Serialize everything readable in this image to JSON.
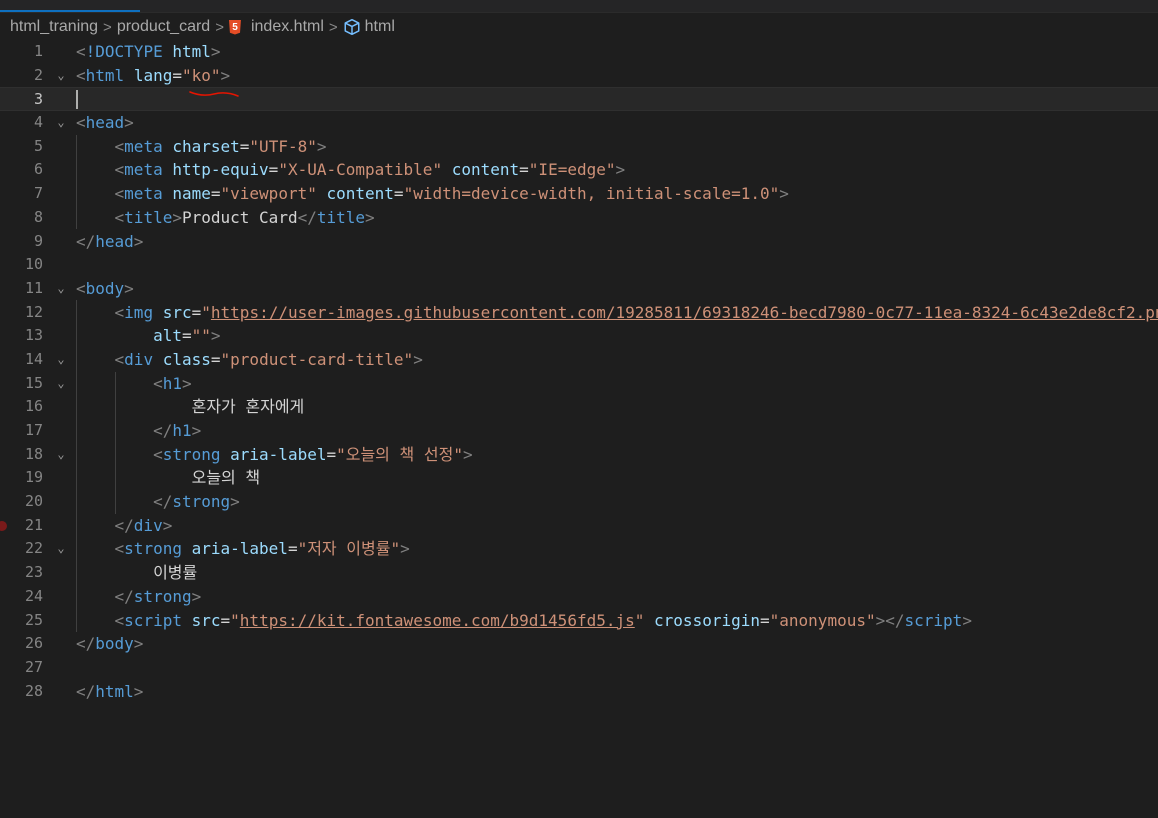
{
  "breadcrumb": {
    "items": [
      "html_traning",
      "product_card",
      "index.html",
      "html"
    ],
    "separator": ">"
  },
  "icons": {
    "file_icon": "html5-icon",
    "symbol_icon": "cube-icon",
    "html5_color": "#e44d26",
    "symbol_color": "#75beff"
  },
  "colors": {
    "background": "#1e1e1e",
    "tag": "#569cd6",
    "attribute": "#9cdcfe",
    "string": "#ce9178",
    "bracket": "#808080",
    "text": "#d4d4d4",
    "line_number": "#858585",
    "squiggle": "#e51400",
    "breakpoint": "#7a1a1a"
  },
  "editor": {
    "current_line": 3,
    "breakpoint_line": 21,
    "lines": [
      {
        "n": "1",
        "fold": "",
        "tokens": [
          {
            "t": "<",
            "c": "tag-b"
          },
          {
            "t": "!DOCTYPE ",
            "c": "tag"
          },
          {
            "t": "html",
            "c": "attr"
          },
          {
            "t": ">",
            "c": "tag-b"
          }
        ]
      },
      {
        "n": "2",
        "fold": "v",
        "tokens": [
          {
            "t": "<",
            "c": "tag-b"
          },
          {
            "t": "html",
            "c": "tag"
          },
          {
            "t": " ",
            "c": "txt"
          },
          {
            "t": "lang",
            "c": "attr"
          },
          {
            "t": "=",
            "c": "txt"
          },
          {
            "t": "\"ko\"",
            "c": "str"
          },
          {
            "t": ">",
            "c": "tag-b"
          }
        ]
      },
      {
        "n": "3",
        "fold": "",
        "tokens": []
      },
      {
        "n": "4",
        "fold": "v",
        "tokens": [
          {
            "t": "<",
            "c": "tag-b"
          },
          {
            "t": "head",
            "c": "tag"
          },
          {
            "t": ">",
            "c": "tag-b"
          }
        ]
      },
      {
        "n": "5",
        "fold": "",
        "tokens": [
          {
            "t": "    ",
            "c": "txt"
          },
          {
            "t": "<",
            "c": "tag-b"
          },
          {
            "t": "meta",
            "c": "tag"
          },
          {
            "t": " ",
            "c": "txt"
          },
          {
            "t": "charset",
            "c": "attr"
          },
          {
            "t": "=",
            "c": "txt"
          },
          {
            "t": "\"UTF-8\"",
            "c": "str"
          },
          {
            "t": ">",
            "c": "tag-b"
          }
        ]
      },
      {
        "n": "6",
        "fold": "",
        "tokens": [
          {
            "t": "    ",
            "c": "txt"
          },
          {
            "t": "<",
            "c": "tag-b"
          },
          {
            "t": "meta",
            "c": "tag"
          },
          {
            "t": " ",
            "c": "txt"
          },
          {
            "t": "http-equiv",
            "c": "attr"
          },
          {
            "t": "=",
            "c": "txt"
          },
          {
            "t": "\"X-UA-Compatible\"",
            "c": "str"
          },
          {
            "t": " ",
            "c": "txt"
          },
          {
            "t": "content",
            "c": "attr"
          },
          {
            "t": "=",
            "c": "txt"
          },
          {
            "t": "\"IE=edge\"",
            "c": "str"
          },
          {
            "t": ">",
            "c": "tag-b"
          }
        ]
      },
      {
        "n": "7",
        "fold": "",
        "tokens": [
          {
            "t": "    ",
            "c": "txt"
          },
          {
            "t": "<",
            "c": "tag-b"
          },
          {
            "t": "meta",
            "c": "tag"
          },
          {
            "t": " ",
            "c": "txt"
          },
          {
            "t": "name",
            "c": "attr"
          },
          {
            "t": "=",
            "c": "txt"
          },
          {
            "t": "\"viewport\"",
            "c": "str"
          },
          {
            "t": " ",
            "c": "txt"
          },
          {
            "t": "content",
            "c": "attr"
          },
          {
            "t": "=",
            "c": "txt"
          },
          {
            "t": "\"width=device-width, initial-scale=1.0\"",
            "c": "str"
          },
          {
            "t": ">",
            "c": "tag-b"
          }
        ]
      },
      {
        "n": "8",
        "fold": "",
        "tokens": [
          {
            "t": "    ",
            "c": "txt"
          },
          {
            "t": "<",
            "c": "tag-b"
          },
          {
            "t": "title",
            "c": "tag"
          },
          {
            "t": ">",
            "c": "tag-b"
          },
          {
            "t": "Product Card",
            "c": "txt"
          },
          {
            "t": "</",
            "c": "tag-b"
          },
          {
            "t": "title",
            "c": "tag"
          },
          {
            "t": ">",
            "c": "tag-b"
          }
        ]
      },
      {
        "n": "9",
        "fold": "",
        "tokens": [
          {
            "t": "</",
            "c": "tag-b"
          },
          {
            "t": "head",
            "c": "tag"
          },
          {
            "t": ">",
            "c": "tag-b"
          }
        ]
      },
      {
        "n": "10",
        "fold": "",
        "tokens": []
      },
      {
        "n": "11",
        "fold": "v",
        "tokens": [
          {
            "t": "<",
            "c": "tag-b"
          },
          {
            "t": "body",
            "c": "tag"
          },
          {
            "t": ">",
            "c": "tag-b"
          }
        ]
      },
      {
        "n": "12",
        "fold": "",
        "tokens": [
          {
            "t": "    ",
            "c": "txt"
          },
          {
            "t": "<",
            "c": "tag-b"
          },
          {
            "t": "img",
            "c": "tag"
          },
          {
            "t": " ",
            "c": "txt"
          },
          {
            "t": "src",
            "c": "attr"
          },
          {
            "t": "=",
            "c": "txt"
          },
          {
            "t": "\"",
            "c": "str"
          },
          {
            "t": "https://user-images.githubusercontent.com/19285811/69318246-becd7980-0c77-11ea-8324-6c43e2de8cf2.png",
            "c": "str url"
          }
        ]
      },
      {
        "n": "13",
        "fold": "",
        "tokens": [
          {
            "t": "        ",
            "c": "txt"
          },
          {
            "t": "alt",
            "c": "attr"
          },
          {
            "t": "=",
            "c": "txt"
          },
          {
            "t": "\"\"",
            "c": "str"
          },
          {
            "t": ">",
            "c": "tag-b"
          }
        ]
      },
      {
        "n": "14",
        "fold": "v",
        "tokens": [
          {
            "t": "    ",
            "c": "txt"
          },
          {
            "t": "<",
            "c": "tag-b"
          },
          {
            "t": "div",
            "c": "tag"
          },
          {
            "t": " ",
            "c": "txt"
          },
          {
            "t": "class",
            "c": "attr"
          },
          {
            "t": "=",
            "c": "txt"
          },
          {
            "t": "\"product-card-title\"",
            "c": "str"
          },
          {
            "t": ">",
            "c": "tag-b"
          }
        ]
      },
      {
        "n": "15",
        "fold": "v",
        "tokens": [
          {
            "t": "        ",
            "c": "txt"
          },
          {
            "t": "<",
            "c": "tag-b"
          },
          {
            "t": "h1",
            "c": "tag"
          },
          {
            "t": ">",
            "c": "tag-b"
          }
        ]
      },
      {
        "n": "16",
        "fold": "",
        "tokens": [
          {
            "t": "            ",
            "c": "txt"
          },
          {
            "t": "혼자가 혼자에게",
            "c": "txt"
          }
        ]
      },
      {
        "n": "17",
        "fold": "",
        "tokens": [
          {
            "t": "        ",
            "c": "txt"
          },
          {
            "t": "</",
            "c": "tag-b"
          },
          {
            "t": "h1",
            "c": "tag"
          },
          {
            "t": ">",
            "c": "tag-b"
          }
        ]
      },
      {
        "n": "18",
        "fold": "v",
        "tokens": [
          {
            "t": "        ",
            "c": "txt"
          },
          {
            "t": "<",
            "c": "tag-b"
          },
          {
            "t": "strong",
            "c": "tag"
          },
          {
            "t": " ",
            "c": "txt"
          },
          {
            "t": "aria-label",
            "c": "attr"
          },
          {
            "t": "=",
            "c": "txt"
          },
          {
            "t": "\"오늘의 책 선정\"",
            "c": "str"
          },
          {
            "t": ">",
            "c": "tag-b"
          }
        ]
      },
      {
        "n": "19",
        "fold": "",
        "tokens": [
          {
            "t": "            ",
            "c": "txt"
          },
          {
            "t": "오늘의 책",
            "c": "txt"
          }
        ]
      },
      {
        "n": "20",
        "fold": "",
        "tokens": [
          {
            "t": "        ",
            "c": "txt"
          },
          {
            "t": "</",
            "c": "tag-b"
          },
          {
            "t": "strong",
            "c": "tag"
          },
          {
            "t": ">",
            "c": "tag-b"
          }
        ]
      },
      {
        "n": "21",
        "fold": "",
        "tokens": [
          {
            "t": "    ",
            "c": "txt"
          },
          {
            "t": "</",
            "c": "tag-b"
          },
          {
            "t": "div",
            "c": "tag"
          },
          {
            "t": ">",
            "c": "tag-b"
          }
        ]
      },
      {
        "n": "22",
        "fold": "v",
        "tokens": [
          {
            "t": "    ",
            "c": "txt"
          },
          {
            "t": "<",
            "c": "tag-b"
          },
          {
            "t": "strong",
            "c": "tag"
          },
          {
            "t": " ",
            "c": "txt"
          },
          {
            "t": "aria-label",
            "c": "attr"
          },
          {
            "t": "=",
            "c": "txt"
          },
          {
            "t": "\"저자 이병률\"",
            "c": "str"
          },
          {
            "t": ">",
            "c": "tag-b"
          }
        ]
      },
      {
        "n": "23",
        "fold": "",
        "tokens": [
          {
            "t": "        ",
            "c": "txt"
          },
          {
            "t": "이병률",
            "c": "txt"
          }
        ]
      },
      {
        "n": "24",
        "fold": "",
        "tokens": [
          {
            "t": "    ",
            "c": "txt"
          },
          {
            "t": "</",
            "c": "tag-b"
          },
          {
            "t": "strong",
            "c": "tag"
          },
          {
            "t": ">",
            "c": "tag-b"
          }
        ]
      },
      {
        "n": "25",
        "fold": "",
        "tokens": [
          {
            "t": "    ",
            "c": "txt"
          },
          {
            "t": "<",
            "c": "tag-b"
          },
          {
            "t": "script",
            "c": "tag"
          },
          {
            "t": " ",
            "c": "txt"
          },
          {
            "t": "src",
            "c": "attr"
          },
          {
            "t": "=",
            "c": "txt"
          },
          {
            "t": "\"",
            "c": "str"
          },
          {
            "t": "https://kit.fontawesome.com/b9d1456fd5.js",
            "c": "str url"
          },
          {
            "t": "\"",
            "c": "str"
          },
          {
            "t": " ",
            "c": "txt"
          },
          {
            "t": "crossorigin",
            "c": "attr"
          },
          {
            "t": "=",
            "c": "txt"
          },
          {
            "t": "\"anonymous\"",
            "c": "str"
          },
          {
            "t": "></",
            "c": "tag-b"
          },
          {
            "t": "script",
            "c": "tag"
          },
          {
            "t": ">",
            "c": "tag-b"
          }
        ]
      },
      {
        "n": "26",
        "fold": "",
        "tokens": [
          {
            "t": "</",
            "c": "tag-b"
          },
          {
            "t": "body",
            "c": "tag"
          },
          {
            "t": ">",
            "c": "tag-b"
          }
        ]
      },
      {
        "n": "27",
        "fold": "",
        "tokens": []
      },
      {
        "n": "28",
        "fold": "",
        "tokens": [
          {
            "t": "</",
            "c": "tag-b"
          },
          {
            "t": "html",
            "c": "tag"
          },
          {
            "t": ">",
            "c": "tag-b"
          }
        ]
      }
    ]
  }
}
